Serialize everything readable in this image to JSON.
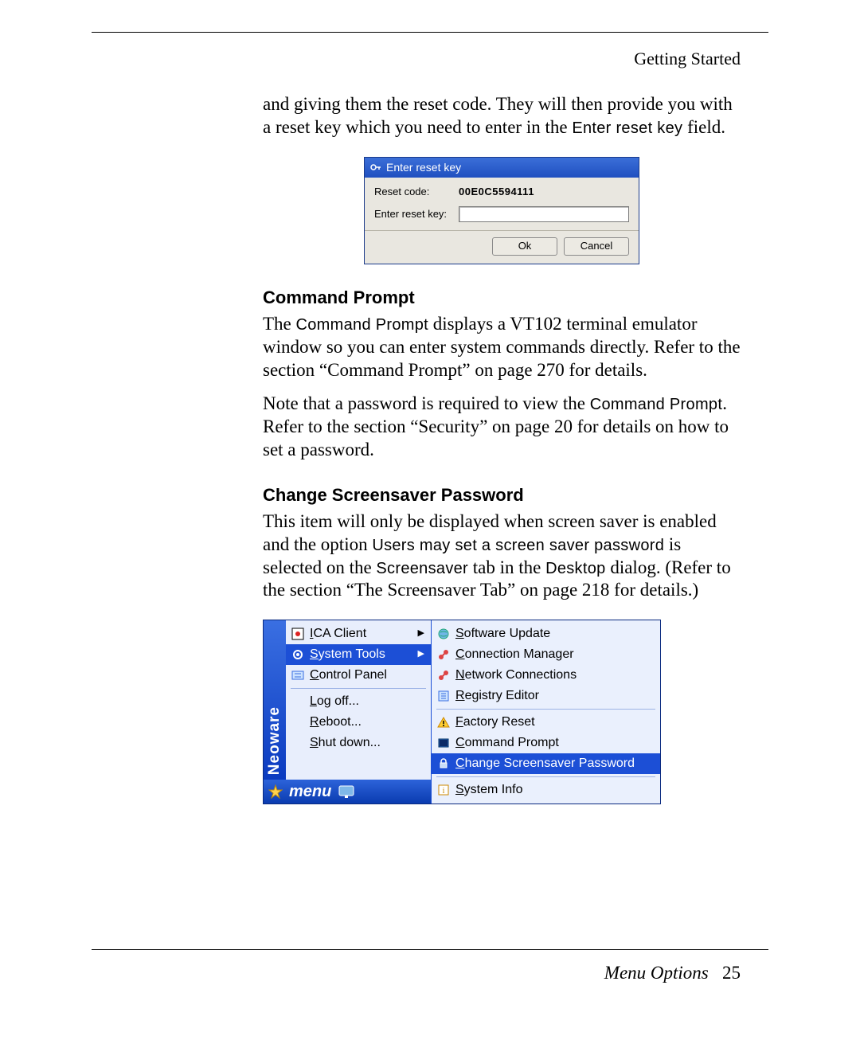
{
  "header": {
    "section": "Getting Started"
  },
  "intro": {
    "text_a": "and giving them the reset code. They will then provide you with a reset key which you need to enter in the ",
    "mono_a": "Enter reset key",
    "text_b": " field."
  },
  "dialog": {
    "title": "Enter reset key",
    "reset_label": "Reset code:",
    "reset_value": "00E0C5594111",
    "enter_label": "Enter reset key:",
    "ok": "Ok",
    "cancel": "Cancel"
  },
  "section_cmd": {
    "heading": "Command Prompt",
    "p1a": "The ",
    "p1m": "Command Prompt",
    "p1b": " displays a VT102 terminal emulator window so you can enter system commands directly. Refer to the section “Command Prompt” on page 270 for details.",
    "p2a": "Note that a password is required to view the ",
    "p2m": "Command Prompt",
    "p2b": ". Refer to the section “Security” on page 20 for details on how to set a password."
  },
  "section_scr": {
    "heading": "Change Screensaver Password",
    "p1a": "This item will only be displayed when screen saver is enabled and the option ",
    "p1m1": "Users may set a screen saver password",
    "p1b": " is selected on the ",
    "p1m2": "Screensaver",
    "p1c": " tab in the ",
    "p1m3": "Desktop",
    "p1d": " dialog. (Refer to the section “The Screensaver Tab” on page 218 for details.)"
  },
  "menu": {
    "brand": "Neoware",
    "taskbar_label": "menu",
    "left": [
      {
        "u": "I",
        "rest": "CA Client",
        "arrow": true,
        "hl": false
      },
      {
        "u": "S",
        "rest": "ystem Tools",
        "arrow": true,
        "hl": true
      },
      {
        "u": "C",
        "rest": "ontrol Panel",
        "arrow": false,
        "hl": false
      }
    ],
    "left_bottom": [
      {
        "u": "L",
        "rest": "og off..."
      },
      {
        "u": "R",
        "rest": "eboot..."
      },
      {
        "u": "S",
        "rest": "hut down..."
      }
    ],
    "right": [
      {
        "u": "S",
        "rest": "oftware Update"
      },
      {
        "u": "C",
        "rest": "onnection Manager"
      },
      {
        "u": "N",
        "rest": "etwork Connections"
      },
      {
        "u": "R",
        "rest": "egistry Editor"
      },
      {
        "u": "F",
        "rest": "actory Reset"
      },
      {
        "u": "C",
        "rest": "ommand Prompt"
      },
      {
        "u": "C",
        "rest": "hange Screensaver Password",
        "hl": true
      },
      {
        "u": "S",
        "rest": "ystem Info"
      }
    ]
  },
  "footer": {
    "label": "Menu Options",
    "page": "25"
  }
}
